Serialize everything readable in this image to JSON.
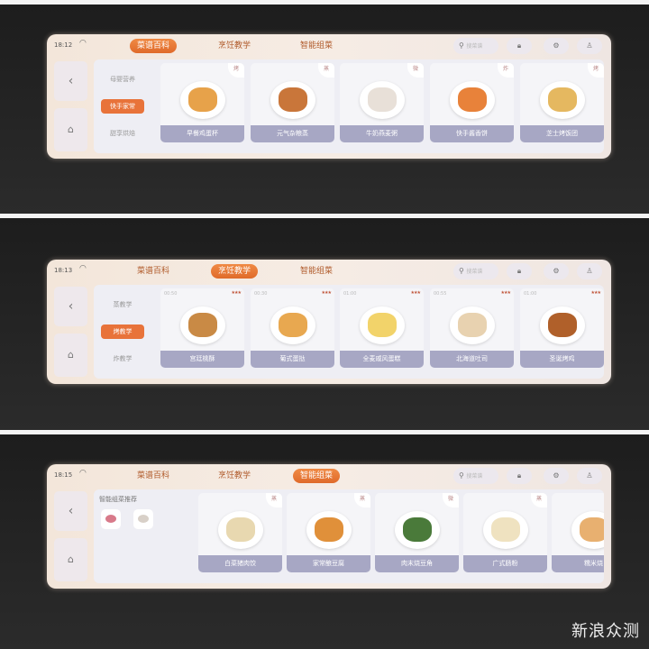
{
  "panels": [
    {
      "time": "18:12",
      "tabs": [
        "菜谱百科",
        "烹饪教学",
        "智能组菜"
      ],
      "active_tab": 0,
      "search_placeholder": "搜菜谱",
      "side_menu": [
        "母婴营养",
        "快手家常",
        "甜享烘焙"
      ],
      "active_menu": 1,
      "cards": [
        {
          "name": "早餐鸡蛋杯",
          "badge": "烤",
          "color": "#e7a24a"
        },
        {
          "name": "元气杂粮蒸",
          "badge": "蒸",
          "color": "#c9763a"
        },
        {
          "name": "牛奶燕麦粥",
          "badge": "微",
          "color": "#e8e0d8"
        },
        {
          "name": "快手酱香饼",
          "badge": "炸",
          "color": "#e8823a"
        },
        {
          "name": "芝士烤饭团",
          "badge": "烤",
          "color": "#e5b860"
        }
      ]
    },
    {
      "time": "18:13",
      "tabs": [
        "菜谱百科",
        "烹饪教学",
        "智能组菜"
      ],
      "active_tab": 1,
      "search_placeholder": "搜菜谱",
      "side_menu": [
        "蒸教学",
        "烤教学",
        "炸教学"
      ],
      "active_menu": 1,
      "cards": [
        {
          "name": "宫廷桃酥",
          "duration": "00:50",
          "stars": "★★★",
          "color": "#c98a45"
        },
        {
          "name": "葡式蛋挞",
          "duration": "00:30",
          "stars": "★★★",
          "color": "#e8a850"
        },
        {
          "name": "全麦戚风蛋糕",
          "duration": "01:00",
          "stars": "★★★",
          "color": "#f2d36a"
        },
        {
          "name": "北海道吐司",
          "duration": "00:55",
          "stars": "★★★",
          "color": "#e8d2b0"
        },
        {
          "name": "圣诞烤鸡",
          "duration": "01:00",
          "stars": "★★★",
          "color": "#b0602a"
        }
      ]
    },
    {
      "time": "18:15",
      "tabs": [
        "菜谱百科",
        "烹饪教学",
        "智能组菜"
      ],
      "active_tab": 2,
      "search_placeholder": "搜菜谱",
      "recommend_title": "智能组菜推荐",
      "thumbs": [
        "#d87a8a",
        "#d8d0c8"
      ],
      "cards": [
        {
          "name": "白菜猪肉饺",
          "badge": "蒸",
          "color": "#e8d8b0"
        },
        {
          "name": "家常酿豆腐",
          "badge": "蒸",
          "color": "#e0903a"
        },
        {
          "name": "肉末烧豆角",
          "badge": "微",
          "color": "#4a7a3a"
        },
        {
          "name": "广式肠粉",
          "badge": "蒸",
          "color": "#efe2c0"
        },
        {
          "name": "糯米烧",
          "badge": "",
          "color": "#e8b070"
        }
      ]
    }
  ],
  "watermark": "新浪众测",
  "colors": {
    "accent": "#e8733a",
    "label_band": "#a7a7c4"
  }
}
